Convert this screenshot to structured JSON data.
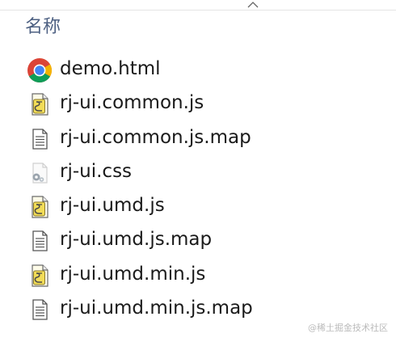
{
  "header": {
    "name_column": "名称"
  },
  "files": [
    {
      "name": "demo.html",
      "icon": "chrome-icon"
    },
    {
      "name": "rj-ui.common.js",
      "icon": "script-file-icon"
    },
    {
      "name": "rj-ui.common.js.map",
      "icon": "text-file-icon"
    },
    {
      "name": "rj-ui.css",
      "icon": "css-file-icon"
    },
    {
      "name": "rj-ui.umd.js",
      "icon": "script-file-icon"
    },
    {
      "name": "rj-ui.umd.js.map",
      "icon": "text-file-icon"
    },
    {
      "name": "rj-ui.umd.min.js",
      "icon": "script-file-icon"
    },
    {
      "name": "rj-ui.umd.min.js.map",
      "icon": "text-file-icon"
    }
  ],
  "watermark": "@稀土掘金技术社区"
}
